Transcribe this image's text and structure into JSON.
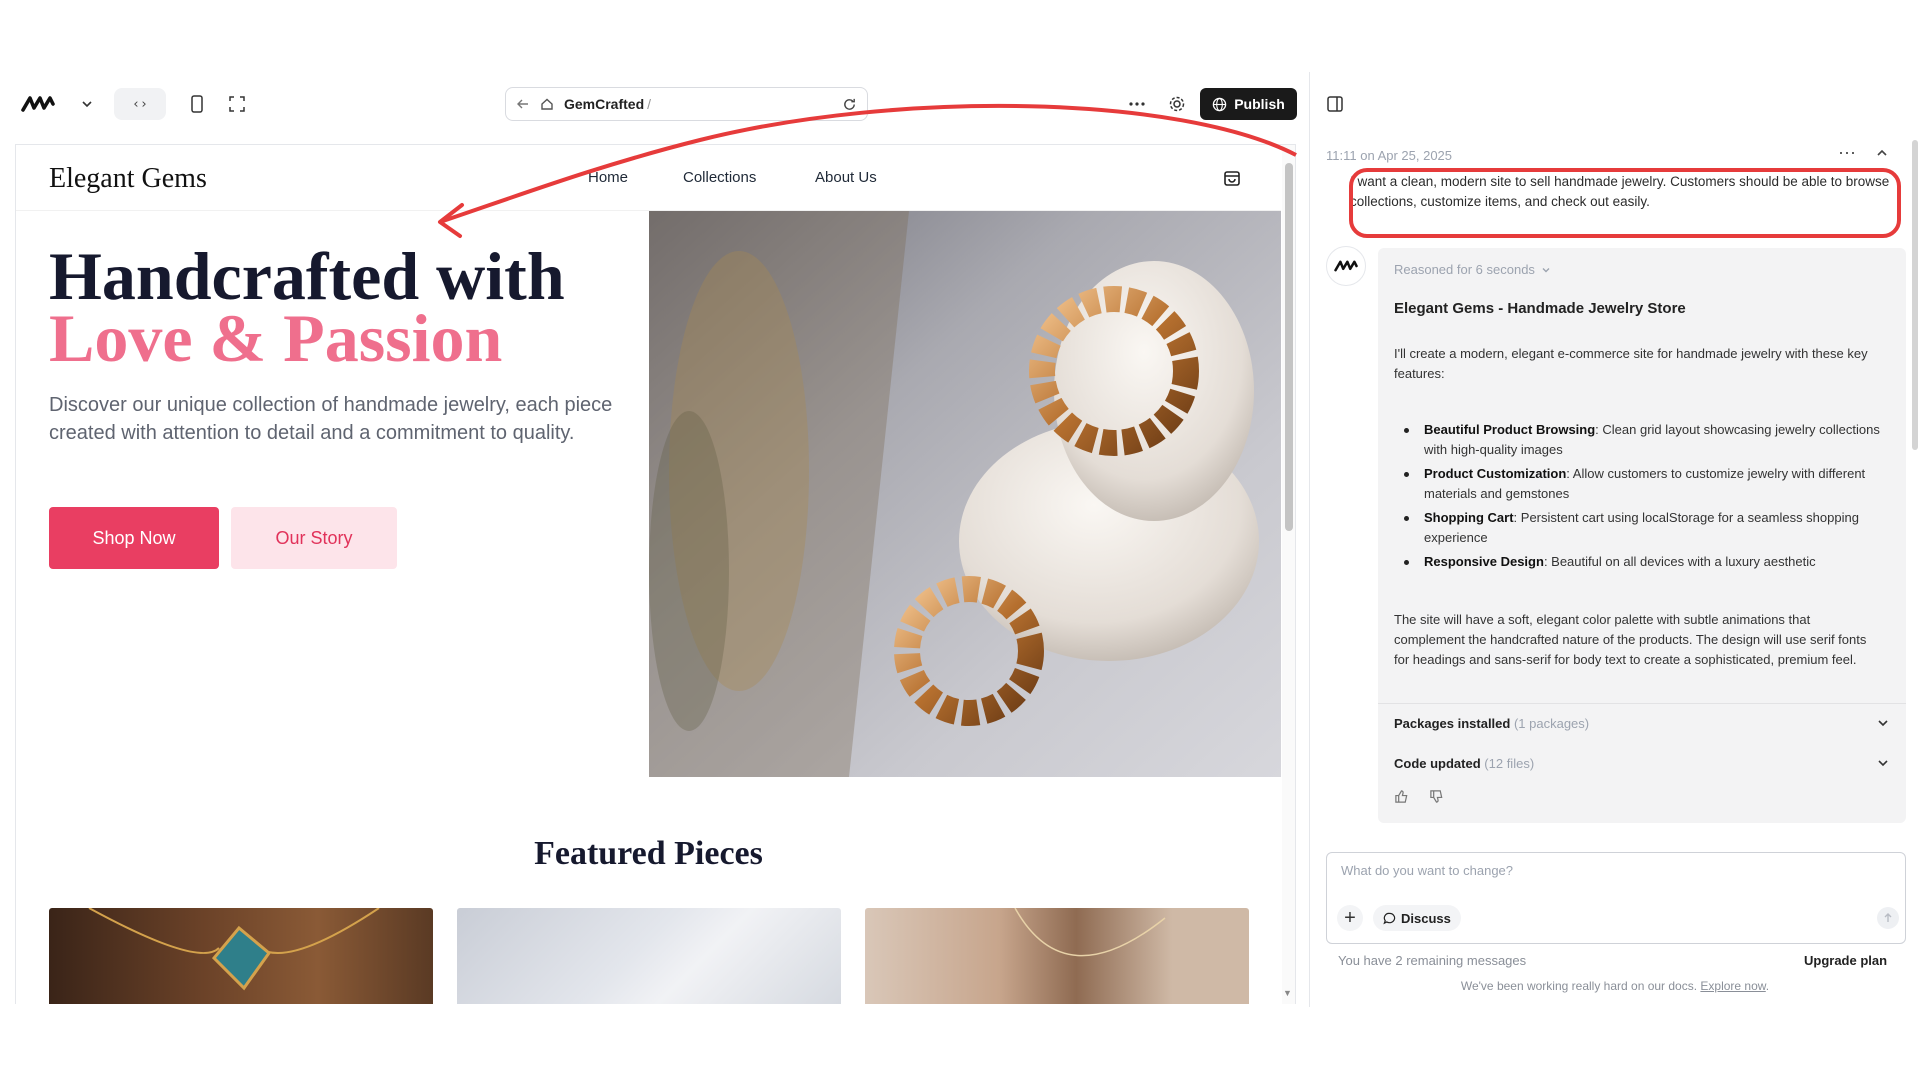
{
  "toolbar": {
    "url_site": "GemCrafted",
    "url_slash": "/",
    "publish_label": "Publish",
    "icons": [
      "logo-icon",
      "chevron-down-icon",
      "code-icon",
      "mobile-icon",
      "fullscreen-icon",
      "back-arrow-icon",
      "home-icon",
      "refresh-icon",
      "more-icon",
      "gear-icon",
      "globe-icon",
      "sidebar-toggle-icon"
    ]
  },
  "site": {
    "logo": "Elegant Gems",
    "nav": [
      "Home",
      "Collections",
      "About Us"
    ],
    "hero_line1": "Handcrafted with",
    "hero_line2": "Love & Passion",
    "hero_desc": "Discover our unique collection of handmade jewelry, each piece created with attention to detail and a commitment to quality.",
    "shop_now": "Shop Now",
    "our_story": "Our Story",
    "featured_title": "Featured Pieces",
    "accent_color": "#e93e62",
    "heading_color": "#16192e"
  },
  "chat": {
    "timestamp": "11:11 on Apr 25, 2025",
    "user_message": "I want a clean, modern site to sell handmade jewelry. Customers should be able to browse collections, customize items, and check out easily.",
    "reasoned": "Reasoned for 6 seconds",
    "title": "Elegant Gems - Handmade Jewelry Store",
    "intro": "I'll create a modern, elegant e-commerce site for handmade jewelry with these key features:",
    "features": [
      {
        "name": "Beautiful Product Browsing",
        "desc": ": Clean grid layout showcasing jewelry collections with high-quality images"
      },
      {
        "name": "Product Customization",
        "desc": ": Allow customers to customize jewelry with different materials and gemstones"
      },
      {
        "name": "Shopping Cart",
        "desc": ": Persistent cart using localStorage for a seamless shopping experience"
      },
      {
        "name": "Responsive Design",
        "desc": ": Beautiful on all devices with a luxury aesthetic"
      }
    ],
    "closing": "The site will have a soft, elegant color palette with subtle animations that complement the handcrafted nature of the products. The design will use serif fonts for headings and sans-serif for body text to create a sophisticated, premium feel.",
    "packages_label": "Packages installed",
    "packages_count": "(1 packages)",
    "code_label": "Code updated",
    "code_count": "(12 files)",
    "input_placeholder": "What do you want to change?",
    "discuss_label": "Discuss",
    "remaining": "You have 2 remaining messages",
    "upgrade": "Upgrade plan",
    "docs_text": "We've been working really hard on our docs.",
    "docs_link": "Explore now",
    "docs_end": "."
  }
}
